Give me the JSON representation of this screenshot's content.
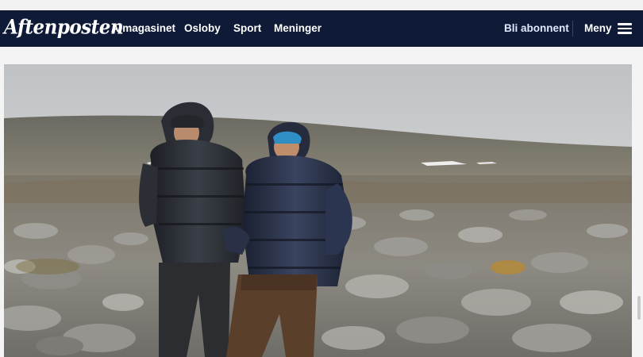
{
  "header": {
    "logo_text": "Aftenposten",
    "nav": [
      "A-magasinet",
      "Osloby",
      "Sport",
      "Meninger"
    ],
    "subscribe_label": "Bli abonnent",
    "menu_label": "Meny",
    "menu_icon": "hamburger-icon"
  },
  "colors": {
    "navbar_bg": "#0f1a36",
    "page_bg": "#f4f4f4"
  },
  "article": {
    "hero_image": "photo of two people in puffer jackets standing on a rocky mountain plateau"
  }
}
